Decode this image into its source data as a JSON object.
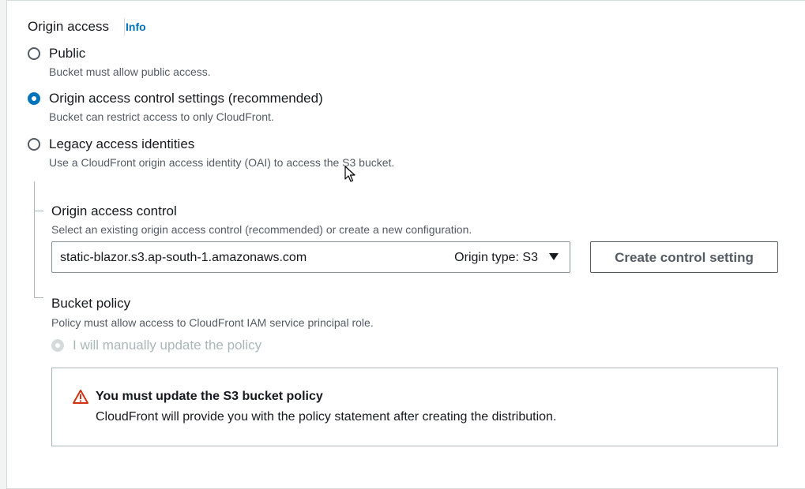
{
  "origin_access": {
    "label": "Origin access",
    "info_link": "Info",
    "options": [
      {
        "label": "Public",
        "description": "Bucket must allow public access.",
        "selected": false
      },
      {
        "label": "Origin access control settings (recommended)",
        "description": "Bucket can restrict access to only CloudFront.",
        "selected": true
      },
      {
        "label": "Legacy access identities",
        "description": "Use a CloudFront origin access identity (OAI) to access the S3 bucket.",
        "selected": false
      }
    ]
  },
  "origin_access_control": {
    "label": "Origin access control",
    "description": "Select an existing origin access control (recommended) or create a new configuration.",
    "selected_value": "static-blazor.s3.ap-south-1.amazonaws.com",
    "selected_meta": "Origin type: S3",
    "create_button": "Create control setting"
  },
  "bucket_policy": {
    "label": "Bucket policy",
    "description": "Policy must allow access to CloudFront IAM service principal role.",
    "option_label": "I will manually update the policy"
  },
  "alert": {
    "title": "You must update the S3 bucket policy",
    "body": "CloudFront will provide you with the policy statement after creating the distribution."
  },
  "colors": {
    "link": "#0073bb",
    "radio_selected": "#0073bb",
    "warning": "#d13212"
  },
  "icons": {
    "alert": "warning-triangle-icon",
    "select_caret": "caret-down-icon"
  }
}
